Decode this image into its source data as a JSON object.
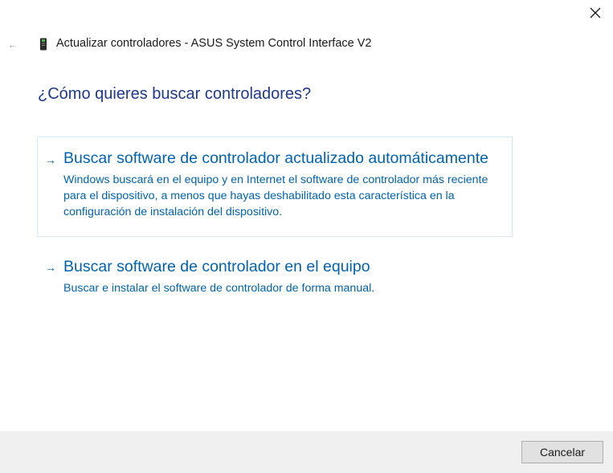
{
  "window": {
    "title": "Actualizar controladores - ASUS System Control Interface V2",
    "back_icon": "back-arrow-icon",
    "close_icon": "close-icon",
    "device_icon": "device-icon"
  },
  "main": {
    "question": "¿Cómo quieres buscar controladores?",
    "options": [
      {
        "arrow": "→",
        "title": "Buscar software de controlador actualizado automáticamente",
        "description": "Windows buscará en el equipo y en Internet el software de controlador más reciente para el dispositivo, a menos que hayas deshabilitado esta característica en la configuración de instalación del dispositivo."
      },
      {
        "arrow": "→",
        "title": "Buscar software de controlador en el equipo",
        "description": "Buscar e instalar el software de controlador de forma manual."
      }
    ]
  },
  "footer": {
    "cancel_label": "Cancelar"
  },
  "colors": {
    "link": "#0063b1",
    "heading": "#1e3a8a",
    "footer_bg": "#f0f0f0",
    "option_border": "#d6e6f5"
  }
}
